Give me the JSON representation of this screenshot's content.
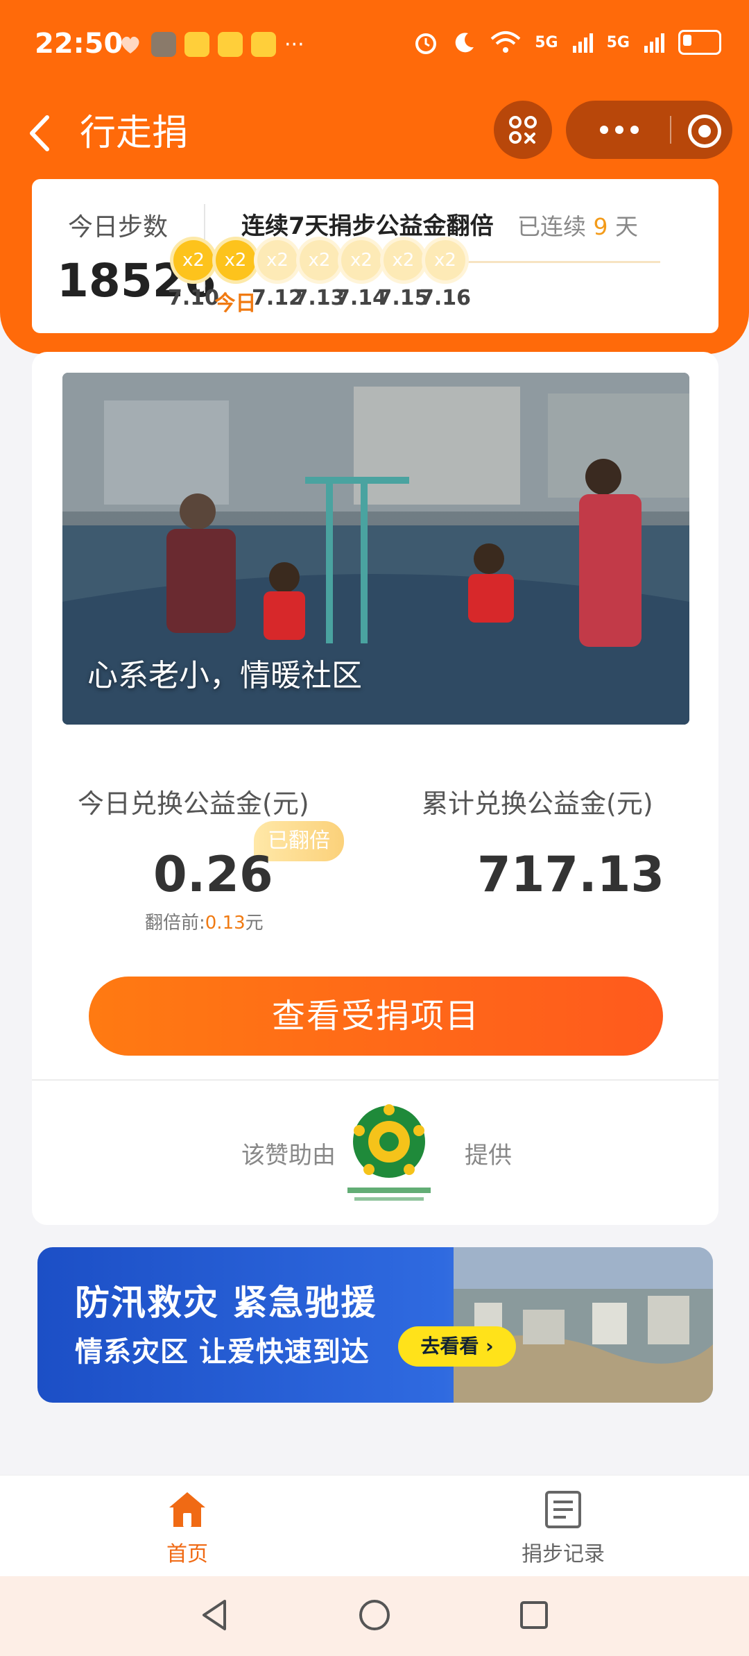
{
  "status_bar": {
    "time": "22:50",
    "network1": "5G",
    "network2": "5G"
  },
  "nav": {
    "title": "行走捐"
  },
  "steps": {
    "label": "今日步数",
    "value": "18526",
    "streak_title": "连续7天捐步公益金翻倍",
    "streak_prefix": "已连续",
    "streak_days": "9",
    "streak_suffix": "天",
    "days": [
      {
        "badge": "x2",
        "label": "7.10",
        "active": true
      },
      {
        "badge": "x2",
        "label": "今日",
        "active": true
      },
      {
        "badge": "x2",
        "label": "7.12",
        "active": false
      },
      {
        "badge": "x2",
        "label": "7.13",
        "active": false
      },
      {
        "badge": "x2",
        "label": "7.14",
        "active": false
      },
      {
        "badge": "x2",
        "label": "7.15",
        "active": false
      },
      {
        "badge": "x2",
        "label": "7.16",
        "active": false
      }
    ]
  },
  "hero": {
    "caption": "心系老小，情暖社区"
  },
  "funds": {
    "today_label": "今日兑换公益金(元)",
    "today_value": "0.26",
    "doubled_badge": "已翻倍",
    "before_label": "翻倍前:",
    "before_value": "0.13",
    "before_unit": "元",
    "total_label": "累计兑换公益金(元)",
    "total_value": "717.13"
  },
  "cta": {
    "label": "查看受捐项目"
  },
  "sponsor": {
    "prefix": "该赞助由",
    "suffix": "提供"
  },
  "banner": {
    "title": "防汛救灾 紧急驰援",
    "subtitle": "情系灾区 让爱快速到达",
    "button": "去看看 ›"
  },
  "tabs": {
    "home": "首页",
    "record": "捐步记录"
  },
  "colors": {
    "primary": "#ff6a0a",
    "accent": "#f07a12",
    "gold": "#fdc31c"
  }
}
